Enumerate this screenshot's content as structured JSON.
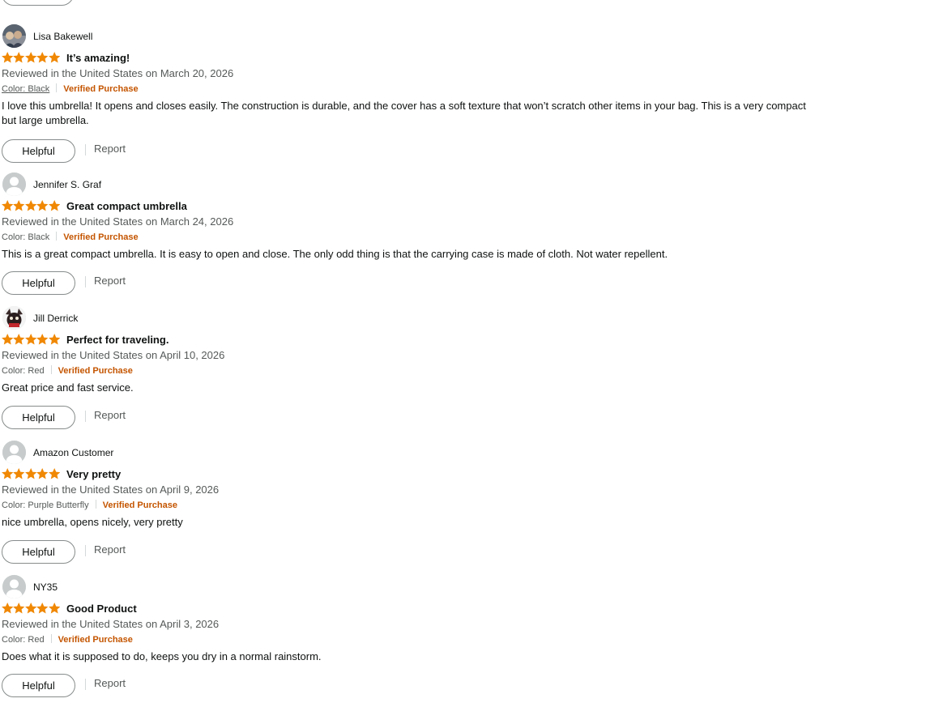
{
  "colors": {
    "star": "#f08804",
    "verified": "#c45500",
    "secondary_text": "#565959",
    "button_border": "#888c8c"
  },
  "reviews": [
    {
      "reviewer": "Lisa Bakewell",
      "avatar": "photo-avatar-icon",
      "rating": 5,
      "title": "It’s amazing!",
      "date": "Reviewed in the United States on March 20, 2026",
      "color": "Color: Black",
      "verified": "Verified Purchase",
      "body": "I love this umbrella! It opens and closes easily. The construction is durable, and the cover has a soft texture that won’t scratch other items in your bag. This is a very compact but large umbrella.",
      "helpful_label": "Helpful",
      "report_label": "Report"
    },
    {
      "reviewer": "Jennifer S. Graf",
      "avatar": "default-user-icon",
      "rating": 5,
      "title": "Great compact umbrella",
      "date": "Reviewed in the United States on March 24, 2026",
      "color": "Color: Black",
      "verified": "Verified Purchase",
      "body": "This is a great compact umbrella. It is easy to open and close. The only odd thing is that the carrying case is made of cloth. Not water repellent.",
      "helpful_label": "Helpful",
      "report_label": "Report"
    },
    {
      "reviewer": "Jill Derrick",
      "avatar": "photo-avatar-icon",
      "rating": 5,
      "title": "Perfect for traveling.",
      "date": "Reviewed in the United States on April 10, 2026",
      "color": "Color: Red",
      "verified": "Verified Purchase",
      "body": "Great price and fast service.",
      "helpful_label": "Helpful",
      "report_label": "Report"
    },
    {
      "reviewer": "Amazon Customer",
      "avatar": "default-user-icon",
      "rating": 5,
      "title": "Very pretty",
      "date": "Reviewed in the United States on April 9, 2026",
      "color": "Color: Purple Butterfly",
      "verified": "Verified Purchase",
      "body": "nice umbrella, opens nicely, very pretty",
      "helpful_label": "Helpful",
      "report_label": "Report"
    },
    {
      "reviewer": "NY35",
      "avatar": "default-user-icon",
      "rating": 5,
      "title": "Good Product",
      "date": "Reviewed in the United States on April 3, 2026",
      "color": "Color: Red",
      "verified": "Verified Purchase",
      "body": "Does what it is supposed to do, keeps you dry in a normal rainstorm.",
      "helpful_label": "Helpful",
      "report_label": "Report"
    }
  ]
}
